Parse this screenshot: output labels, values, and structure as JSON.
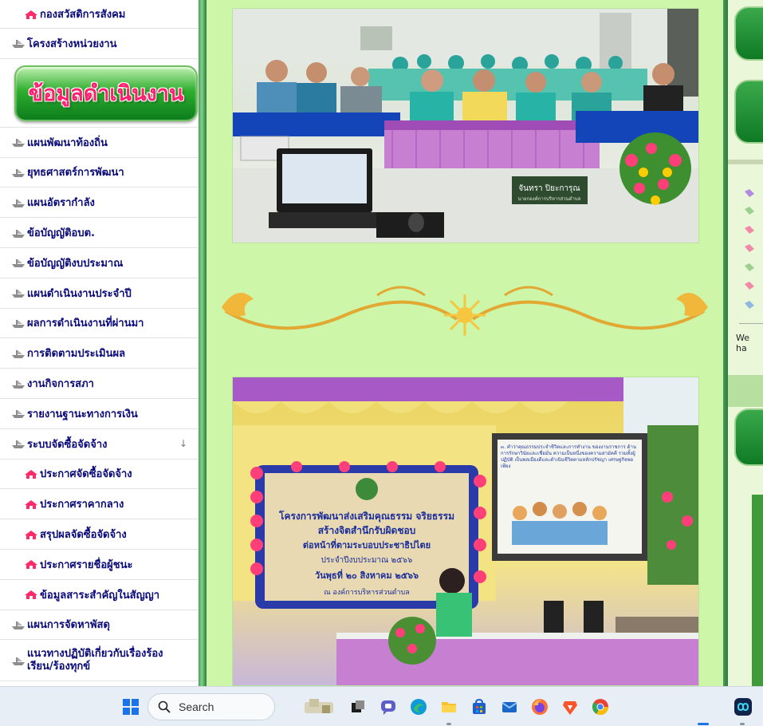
{
  "sidebar": {
    "top_item": "กองสวัสดิการสังคม",
    "items_a": [
      "โครงสร้างหน่วยงาน"
    ],
    "section_title": "ข้อมูลดำเนินงาน",
    "items_b": [
      "แผนพัฒนาท้องถิ่น",
      "ยุทธศาสตร์การพัฒนา",
      "แผนอัตรากำลัง",
      "ข้อบัญญัติอบต.",
      "ข้อบัญญัติงบประมาณ",
      "แผนดำเนินงานประจำปี",
      "ผลการดำเนินงานที่ผ่านมา",
      "การติดตามประเมินผล",
      "งานกิจการสภา",
      "รายงานฐานะทางการเงิน",
      "ระบบจัดซื้อจัดจ้าง"
    ],
    "procurement_arrow": "↓",
    "sub_items": [
      "ประกาศจัดซื้อจัดจ้าง",
      "ประกาศราคากลาง",
      "สรุปผลจัดซื้อจัดจ้าง",
      "ประกาศรายชื่อผู้ชนะ",
      "ข้อมูลสาระสำคัญในสัญญา"
    ],
    "items_c": [
      "แผนการจัดหาพัสดุ"
    ],
    "two_line_item": "แนวทางปฏิบัติเกี่ยวกับเรื่องร้องเรียน/ร้องทุกข์",
    "icon_color_house": "#ff2a6a",
    "icon_color_ship": "#8d8d8d"
  },
  "content": {
    "photo1": {
      "name_card": "จันทรา ปิยะการุณ",
      "name_card_sub": "นายกองค์การบริหารส่วนตำบล"
    },
    "photo2": {
      "banner_line1": "โครงการพัฒนาส่งเสริมคุณธรรม จริยธรรม",
      "banner_line2": "สร้างจิตสำนึกรับผิดชอบ",
      "banner_line3": "ต่อหน้าที่ตามระบอบประชาธิปไตย",
      "banner_line4": "ประจำปีงบประมาณ ๒๕๖๖",
      "banner_date": "วันพุธที่ ๒๐ สิงหาคม ๒๕๖๖",
      "banner_place": "ณ องค์การบริหารส่วนตำบล",
      "screen_text": "๓. คำว่าคุณธรรมประจำชีวิตและการทำงาน ของงานราชการ ด้านการรักษาวินัยและเชื่อมั่น ความเป็นหนึ่งของความสามัคคี รวมทั้งผู้ปฏิบัติ เป็นพลเมืองดีและดำเนินชีวิตตามหลักปรัชญา เศรษฐกิจพอเพียง"
    }
  },
  "right": {
    "fragment_text": "We ha"
  },
  "taskbar": {
    "search_placeholder": "Search",
    "colors": {
      "windows": "#1a73e8",
      "edge": "#0f9ad8",
      "firefox": "#ff7139",
      "brave": "#fb542b",
      "chrome_red": "#ea4335"
    }
  }
}
